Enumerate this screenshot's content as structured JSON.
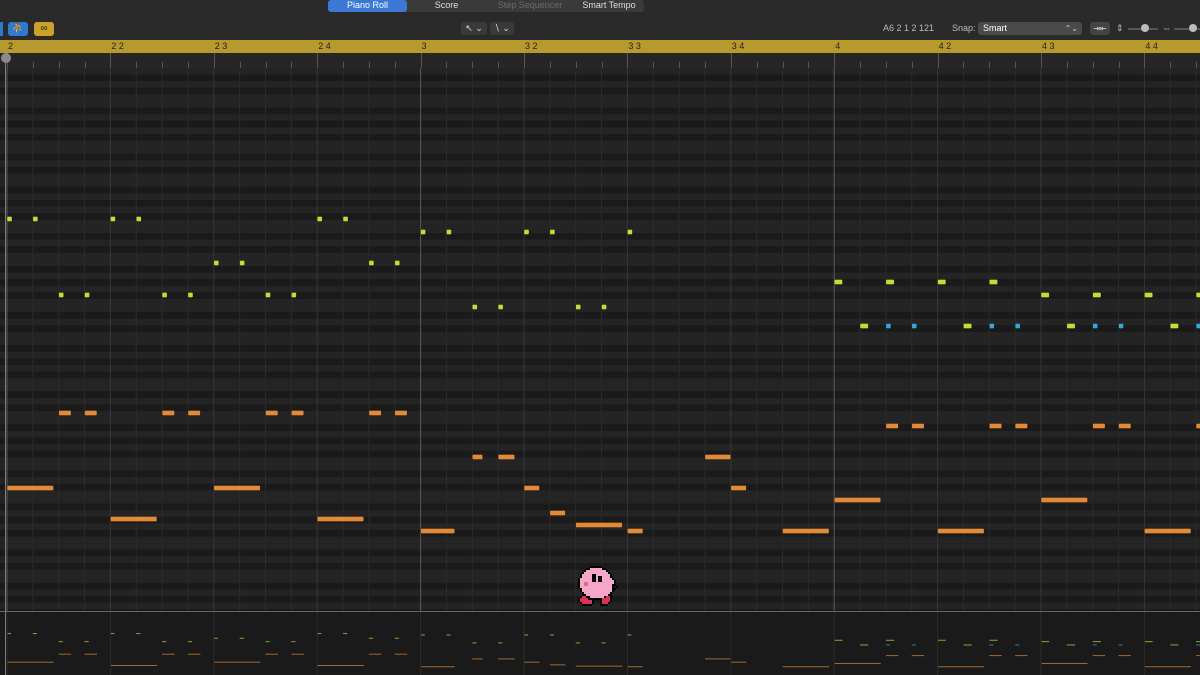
{
  "toolbar": {
    "tabs": [
      {
        "label": "Piano Roll",
        "active": true
      },
      {
        "label": "Score",
        "active": false
      },
      {
        "label": "Step Sequencer",
        "active": false,
        "disabled": true
      },
      {
        "label": "Smart Tempo",
        "active": false
      }
    ],
    "catch_icon": "catch-playhead-icon",
    "link_icon": "link-icon",
    "pointer_tool_glyph": "↖ ⌄",
    "pencil_tool_glyph": "∖ ⌄",
    "position_readout": "A6   2 1 2 121",
    "snap_label": "Snap:",
    "snap_value": "Smart",
    "fit_glyph": "⇥⇤",
    "vzoom_glyph": "⇕",
    "hzoom_glyph": "⇔"
  },
  "ruler": {
    "bars": [
      "2",
      "2 2",
      "2 3",
      "2 4",
      "3",
      "3 2",
      "3 3",
      "3 4",
      "4",
      "4 2",
      "4 3",
      "4 4"
    ]
  },
  "colors": {
    "green_note": "#c8d93a",
    "orange_note": "#e08a3a",
    "blue_note": "#3aa6d8",
    "ruler": "#b79a2e",
    "accent": "#3b79d4"
  },
  "notes": {
    "green": [
      {
        "beat": 0.0,
        "row": 1
      },
      {
        "beat": 0.25,
        "row": 1
      },
      {
        "beat": 1.0,
        "row": 1
      },
      {
        "beat": 1.25,
        "row": 1
      },
      {
        "beat": 3.0,
        "row": 1
      },
      {
        "beat": 3.25,
        "row": 1
      },
      {
        "beat": 4.0,
        "row": 2
      },
      {
        "beat": 4.25,
        "row": 2
      },
      {
        "beat": 5.0,
        "row": 2
      },
      {
        "beat": 5.25,
        "row": 2
      },
      {
        "beat": 6.0,
        "row": 2
      },
      {
        "beat": 2.0,
        "row": 3
      },
      {
        "beat": 2.25,
        "row": 3
      },
      {
        "beat": 3.5,
        "row": 3
      },
      {
        "beat": 3.75,
        "row": 3
      },
      {
        "beat": 0.5,
        "row": 4
      },
      {
        "beat": 0.75,
        "row": 4
      },
      {
        "beat": 1.5,
        "row": 4
      },
      {
        "beat": 1.75,
        "row": 4
      },
      {
        "beat": 2.5,
        "row": 4
      },
      {
        "beat": 2.75,
        "row": 4
      },
      {
        "beat": 4.5,
        "row": 5
      },
      {
        "beat": 4.75,
        "row": 5
      },
      {
        "beat": 5.5,
        "row": 5
      },
      {
        "beat": 5.75,
        "row": 5
      },
      {
        "beat": 8.0,
        "row": 6,
        "len": 0.08
      },
      {
        "beat": 8.5,
        "row": 6,
        "len": 0.08
      },
      {
        "beat": 9.0,
        "row": 6,
        "len": 0.08
      },
      {
        "beat": 9.5,
        "row": 6,
        "len": 0.08
      },
      {
        "beat": 10.0,
        "row": 4,
        "len": 0.08
      },
      {
        "beat": 10.5,
        "row": 4,
        "len": 0.08
      },
      {
        "beat": 11.0,
        "row": 4,
        "len": 0.08
      },
      {
        "beat": 11.5,
        "row": 4,
        "len": 0.08
      },
      {
        "beat": 8.25,
        "row": 7,
        "len": 0.08
      },
      {
        "beat": 9.25,
        "row": 7,
        "len": 0.08
      },
      {
        "beat": 10.25,
        "row": 7,
        "len": 0.08
      },
      {
        "beat": 11.25,
        "row": 7,
        "len": 0.08
      }
    ],
    "blue": [
      {
        "beat": 8.5,
        "row": 7
      },
      {
        "beat": 8.75,
        "row": 7
      },
      {
        "beat": 9.5,
        "row": 7
      },
      {
        "beat": 9.75,
        "row": 7
      },
      {
        "beat": 10.5,
        "row": 7
      },
      {
        "beat": 10.75,
        "row": 7
      },
      {
        "beat": 11.5,
        "row": 7
      }
    ],
    "orange": [
      {
        "beat": 0.5,
        "row": 8,
        "len": 0.12
      },
      {
        "beat": 0.75,
        "row": 8,
        "len": 0.12
      },
      {
        "beat": 1.5,
        "row": 8,
        "len": 0.12
      },
      {
        "beat": 1.75,
        "row": 8,
        "len": 0.12
      },
      {
        "beat": 2.5,
        "row": 8,
        "len": 0.12
      },
      {
        "beat": 2.75,
        "row": 8,
        "len": 0.12
      },
      {
        "beat": 3.5,
        "row": 8,
        "len": 0.12
      },
      {
        "beat": 3.75,
        "row": 8,
        "len": 0.12
      },
      {
        "beat": 8.5,
        "row": 9,
        "len": 0.12
      },
      {
        "beat": 8.75,
        "row": 9,
        "len": 0.12
      },
      {
        "beat": 9.5,
        "row": 9,
        "len": 0.12
      },
      {
        "beat": 9.75,
        "row": 9,
        "len": 0.12
      },
      {
        "beat": 10.5,
        "row": 9,
        "len": 0.12
      },
      {
        "beat": 10.75,
        "row": 9,
        "len": 0.12
      },
      {
        "beat": 11.5,
        "row": 9,
        "len": 0.12
      },
      {
        "beat": 4.5,
        "row": 10,
        "len": 0.1
      },
      {
        "beat": 4.75,
        "row": 10,
        "len": 0.16
      },
      {
        "beat": 6.75,
        "row": 10,
        "len": 0.25
      },
      {
        "beat": 0.0,
        "row": 11,
        "len": 0.45
      },
      {
        "beat": 2.0,
        "row": 11,
        "len": 0.45
      },
      {
        "beat": 5.0,
        "row": 11,
        "len": 0.15
      },
      {
        "beat": 7.0,
        "row": 11,
        "len": 0.15
      },
      {
        "beat": 8.0,
        "row": 12,
        "len": 0.45
      },
      {
        "beat": 10.0,
        "row": 12,
        "len": 0.45
      },
      {
        "beat": 5.25,
        "row": 13,
        "len": 0.15
      },
      {
        "beat": 1.0,
        "row": 14,
        "len": 0.45
      },
      {
        "beat": 3.0,
        "row": 14,
        "len": 0.45
      },
      {
        "beat": 5.5,
        "row": 15,
        "len": 0.45
      },
      {
        "beat": 4.0,
        "row": 16,
        "len": 0.33
      },
      {
        "beat": 6.0,
        "row": 16,
        "len": 0.15
      },
      {
        "beat": 7.5,
        "row": 16,
        "len": 0.45
      },
      {
        "beat": 9.0,
        "row": 16,
        "len": 0.45
      },
      {
        "beat": 11.0,
        "row": 16,
        "len": 0.45
      }
    ]
  },
  "kirby": {
    "name": "kirby-sprite",
    "body": "#f4a7c9",
    "cheek": "#e56a9a",
    "feet": "#d7325a",
    "outline": "#000000"
  }
}
